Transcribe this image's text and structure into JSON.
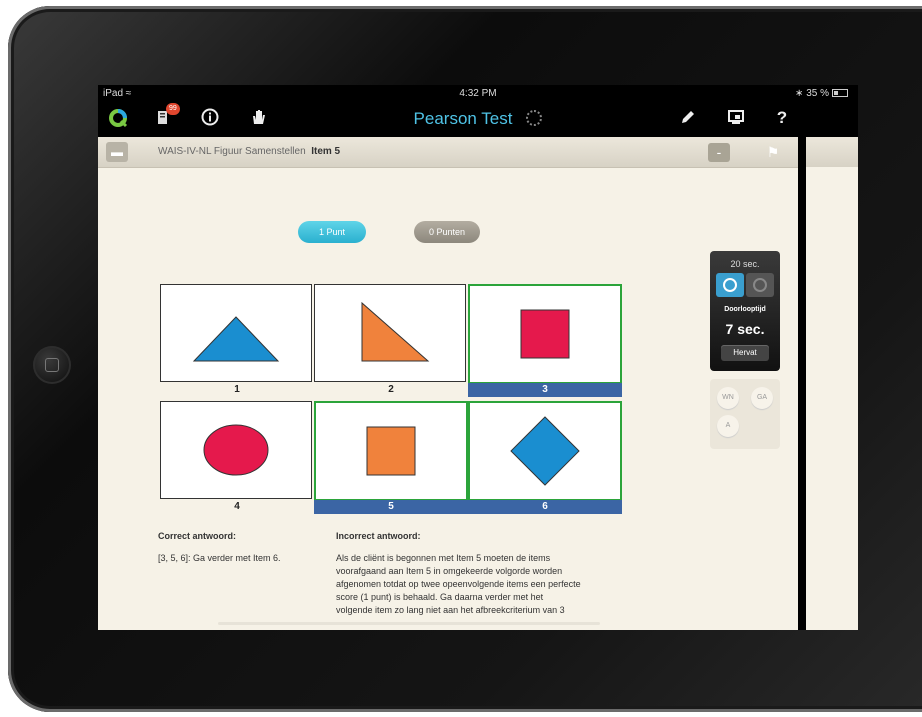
{
  "status_bar": {
    "device": "iPad",
    "time": "4:32 PM",
    "battery": "35 %"
  },
  "toolbar": {
    "title": "Pearson Test",
    "badge": "99",
    "help_label": "?"
  },
  "header": {
    "title_prefix": "WAIS-IV-NL Figuur Samenstellen",
    "title_item": "Item 5",
    "minus_label": "-"
  },
  "scoring": {
    "option1": "1 Punt",
    "option2": "0 Punten"
  },
  "grid": {
    "cells": [
      {
        "label": "1",
        "shape": "triangle",
        "color": "#1a8ed0",
        "selected": false
      },
      {
        "label": "2",
        "shape": "right-triangle",
        "color": "#f0823c",
        "selected": false
      },
      {
        "label": "3",
        "shape": "square",
        "color": "#e5194c",
        "selected": true
      },
      {
        "label": "4",
        "shape": "ellipse",
        "color": "#e5194c",
        "selected": false
      },
      {
        "label": "5",
        "shape": "square",
        "color": "#f0823c",
        "selected": true
      },
      {
        "label": "6",
        "shape": "diamond",
        "color": "#1a8ed0",
        "selected": true
      }
    ]
  },
  "correct": {
    "heading": "Correct antwoord:",
    "text": "[3, 5, 6]: Ga verder met Item 6."
  },
  "incorrect": {
    "heading": "Incorrect antwoord:",
    "lines": [
      "Als de cliënt is begonnen met Item 5 moeten de items",
      "voorafgaand aan Item 5 in omgekeerde volgorde worden",
      "afgenomen totdat op twee opeenvolgende items een perfecte",
      "score (1 punt) is behaald. Ga daarna verder met het",
      "volgende item zo lang niet aan het afbreekcriterium van 3"
    ]
  },
  "timer": {
    "limit": "20 sec.",
    "elapsed_label": "Doorlooptijd",
    "elapsed_value": "7 sec.",
    "resume_label": "Hervat"
  },
  "response_codes": {
    "wn": "WN",
    "ga": "GA",
    "a": "A"
  }
}
